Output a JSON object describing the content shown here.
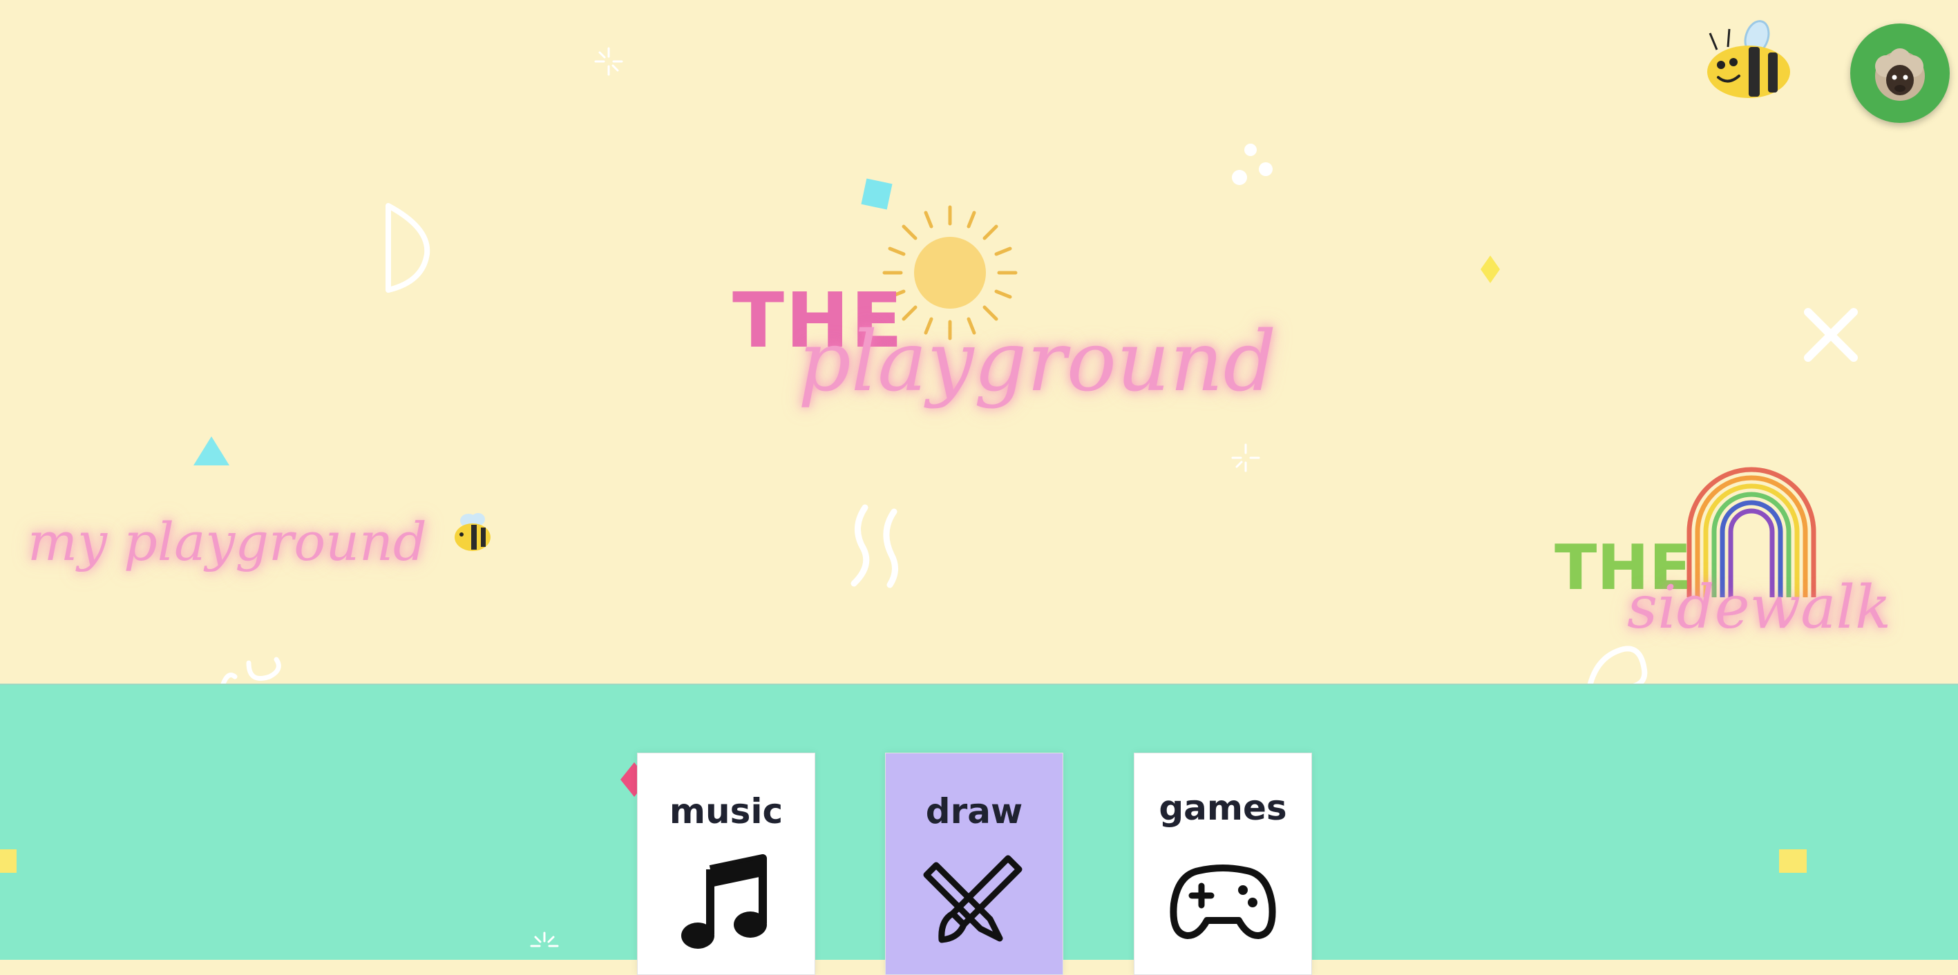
{
  "header": {
    "logo": {
      "the": "THE",
      "script": "playground"
    },
    "my_playground_link": "my playground",
    "sidewalk_link": {
      "the": "THE",
      "script": "sidewalk"
    },
    "bee_icon": "bee-icon",
    "avatar_icon": "sheep-avatar-icon"
  },
  "activities": [
    {
      "label": "music",
      "icon": "music-note-icon",
      "bg": "#ffffff"
    },
    {
      "label": "draw",
      "icon": "pencil-brush-icon",
      "bg": "#c4b8f6"
    },
    {
      "label": "games",
      "icon": "game-controller-icon",
      "bg": "#ffffff"
    }
  ],
  "colors": {
    "top_background": "#fcf2c8",
    "bottom_background": "#86e9c9",
    "accent_pink": "#e96fae",
    "accent_green": "#8acc55",
    "avatar_green": "#4caf50"
  }
}
